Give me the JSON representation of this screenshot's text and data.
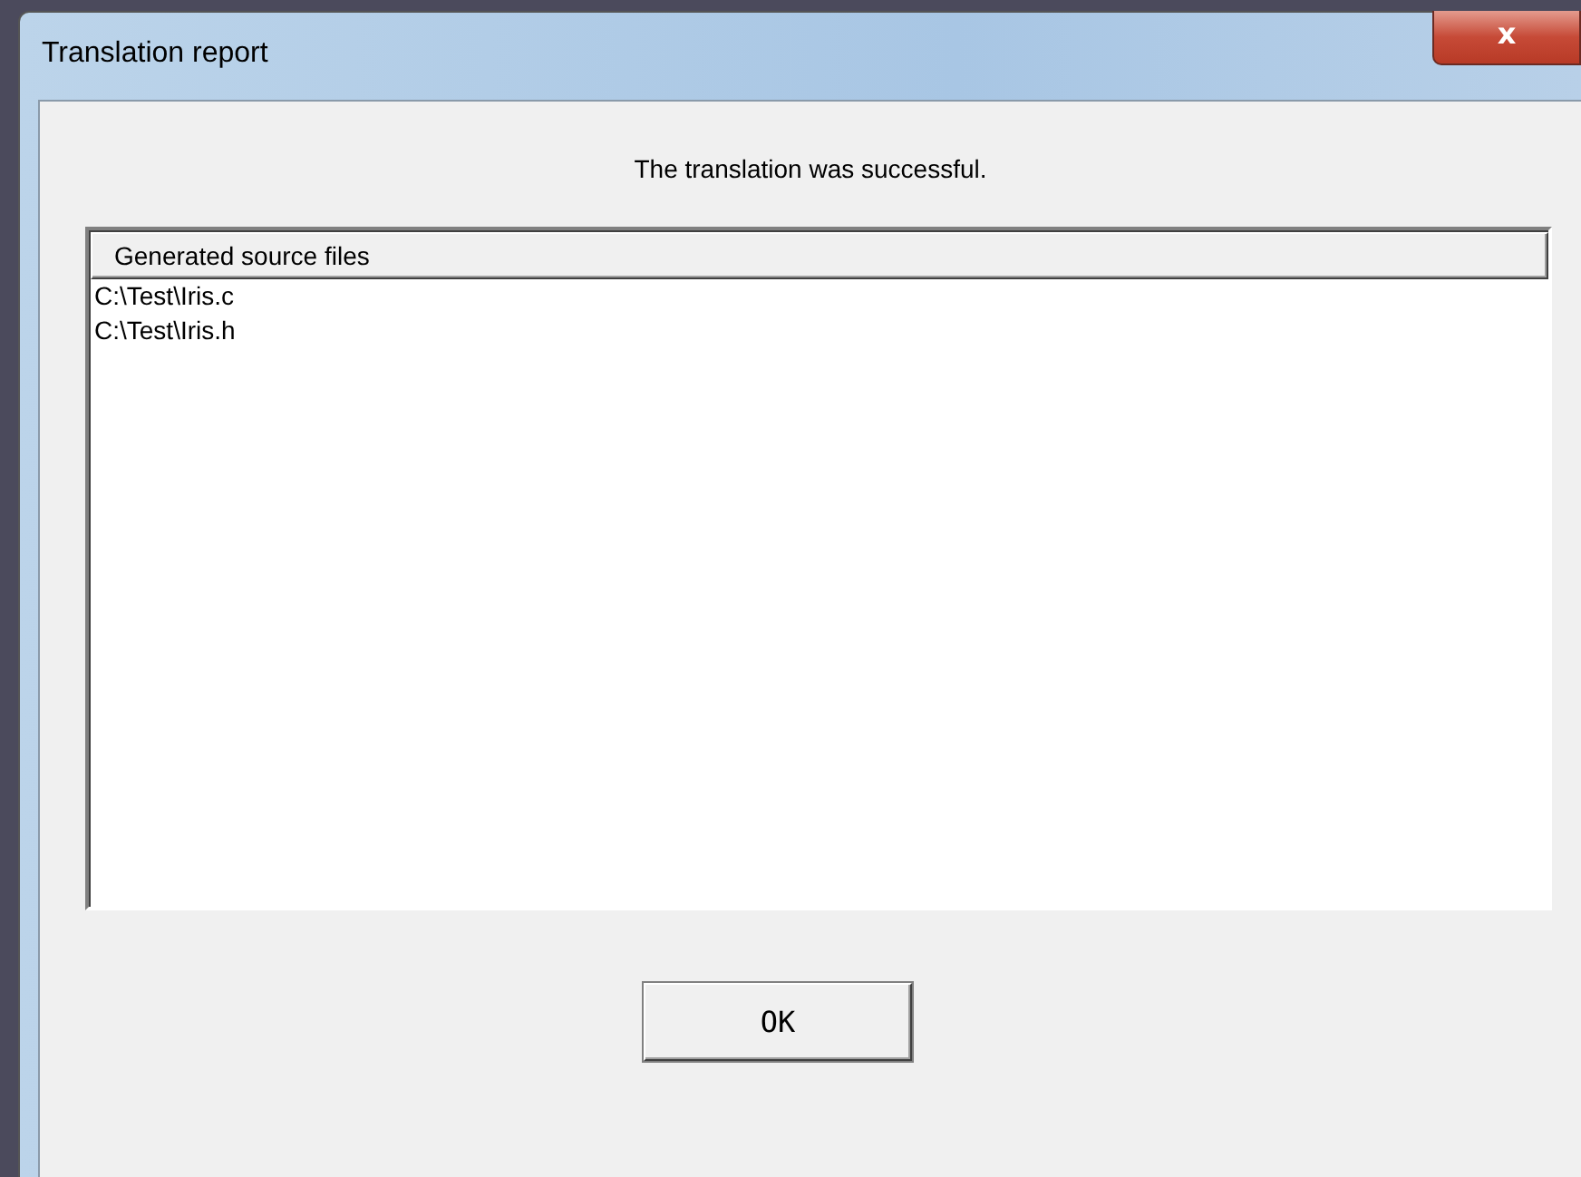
{
  "window": {
    "title": "Translation report",
    "close": "x"
  },
  "message": "The translation was successful.",
  "list": {
    "columns": [
      "Generated source files"
    ],
    "rows": [
      "C:\\Test\\Iris.c",
      "C:\\Test\\Iris.h"
    ]
  },
  "buttons": [
    "OK"
  ]
}
